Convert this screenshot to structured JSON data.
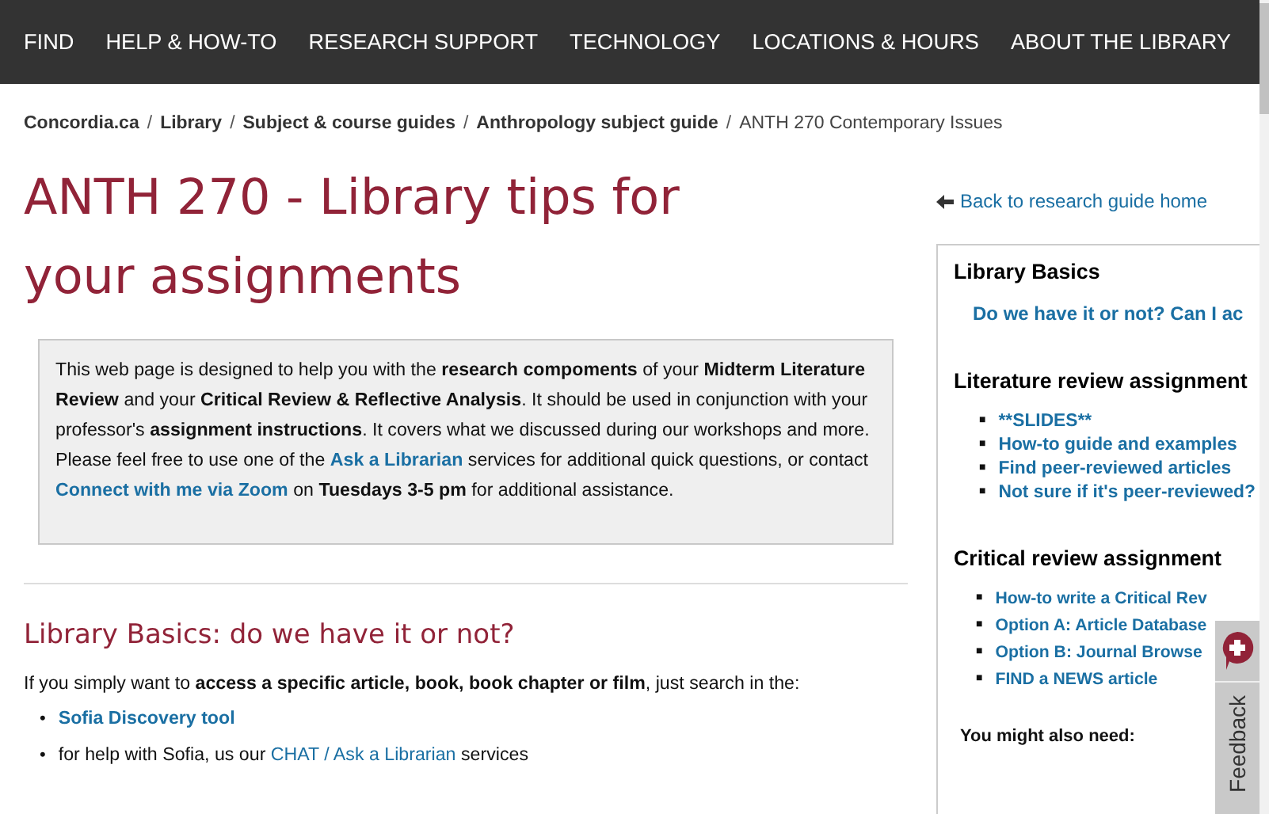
{
  "nav": [
    "FIND",
    "HELP & HOW-TO",
    "RESEARCH SUPPORT",
    "TECHNOLOGY",
    "LOCATIONS & HOURS",
    "ABOUT THE LIBRARY"
  ],
  "breadcrumb": [
    {
      "label": "Concordia.ca",
      "kind": "link"
    },
    {
      "separator": "/",
      "label": "Library",
      "kind": "link"
    },
    {
      "separator": "/",
      "label": "Subject & course guides",
      "kind": "link"
    },
    {
      "separator": "/",
      "label": "Anthropology subject guide",
      "kind": "link"
    },
    {
      "separator": "/",
      "label": "ANTH 270 Contemporary Issues",
      "kind": "current"
    }
  ],
  "title": "ANTH 270 - Library tips for your assignments",
  "intro": [
    {
      "text": "This web page is designed to help you with the ",
      "kind": "plain"
    },
    {
      "text": "research compoments",
      "kind": "bold"
    },
    {
      "text": " of your ",
      "kind": "plain"
    },
    {
      "text": "Midterm Literature Review",
      "kind": "bold"
    },
    {
      "text": " and your ",
      "kind": "plain"
    },
    {
      "text": "Critical Review & Reflective Analysis",
      "kind": "bold"
    },
    {
      "text": ". It should be used in conjunction with your professor's ",
      "kind": "plain"
    },
    {
      "text": "assignment instructions",
      "kind": "bold"
    },
    {
      "text": ". It covers what we discussed during our workshops and more. Please feel free to use one of the ",
      "kind": "plain"
    },
    {
      "text": "Ask a Librarian",
      "kind": "link"
    },
    {
      "text": " services for additional quick questions, or contact ",
      "kind": "plain"
    },
    {
      "text": "Connect with me via Zoom",
      "kind": "link"
    },
    {
      "text": " on ",
      "kind": "plain"
    },
    {
      "text": "Tuesdays 3-5 pm",
      "kind": "bold"
    },
    {
      "text": " for additional assistance.",
      "kind": "plain"
    }
  ],
  "section": {
    "heading": "Library Basics: do we have it or not?",
    "text": "If you simply want to **access a specific article, book, book chapter or film**, just search in the:",
    "bullets": [
      {
        "marker": "•",
        "parts": [
          {
            "text": "Sofia Discovery tool",
            "kind": "link"
          }
        ]
      },
      {
        "marker": "•",
        "parts": [
          {
            "text": "for help with Sofia, us our ",
            "kind": "plain"
          },
          {
            "text": "CHAT / Ask a Librarian",
            "kind": "link"
          },
          {
            "text": " services",
            "kind": "plain"
          }
        ]
      }
    ]
  },
  "sidebar": {
    "back_link": "Back to research guide home",
    "groups": [
      {
        "heading": "Library Basics",
        "links": [
          {
            "text": "Do we have it or not? Can I ac"
          }
        ]
      },
      {
        "heading": "Literature review assignment",
        "links": [
          {
            "marker": "■",
            "text": "**SLIDES**"
          },
          {
            "marker": "■",
            "text": "How-to guide and examples"
          },
          {
            "marker": "■",
            "text": "Find peer-reviewed articles"
          },
          {
            "marker": "■",
            "text": "Not sure if it's peer-reviewed?"
          }
        ]
      },
      {
        "heading": "Critical review assignment",
        "links": [
          {
            "marker": "■",
            "text": "How-to write a Critical Rev"
          },
          {
            "marker": "■",
            "text": "Option A: Article Database"
          },
          {
            "marker": "■",
            "text": "Option B: Journal Browse"
          },
          {
            "marker": "■",
            "text": "FIND a NEWS article"
          }
        ]
      }
    ],
    "footer_label": "You might also need:"
  },
  "feedback": "Feedback"
}
